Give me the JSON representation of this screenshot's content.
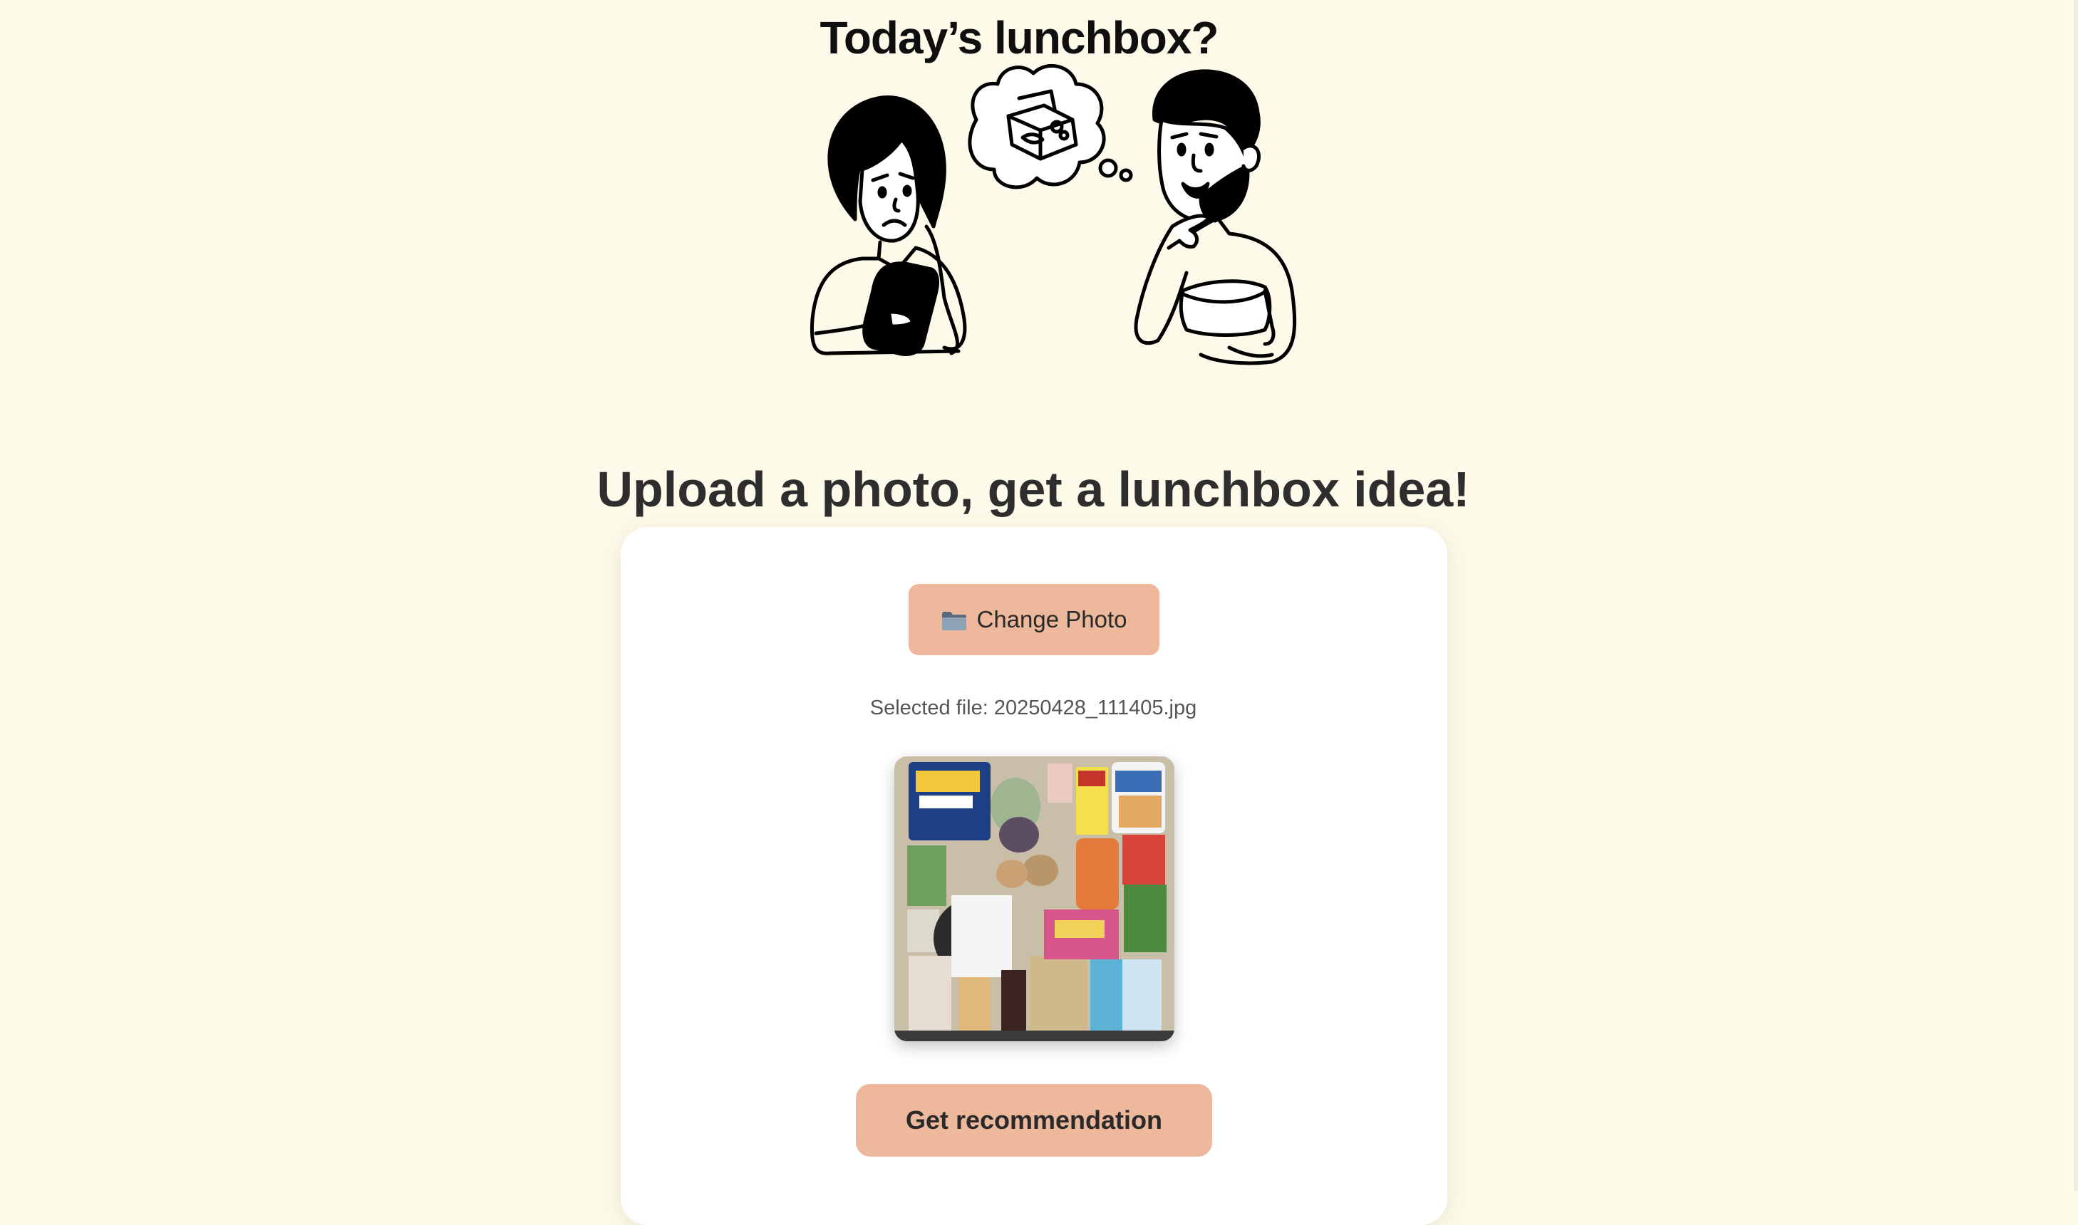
{
  "header": {
    "title": "Today’s lunchbox?"
  },
  "main": {
    "headline": "Upload a photo, get a lunchbox idea!"
  },
  "upload": {
    "change_photo_label": "Change Photo",
    "change_photo_icon": "folder-icon",
    "selected_file_text": "Selected file: 20250428_111405.jpg",
    "preview_image": "uploaded-photo-preview"
  },
  "actions": {
    "recommend_label": "Get recommendation"
  },
  "colors": {
    "background": "#fdfaea",
    "card": "#ffffff",
    "button": "#edb89c",
    "text": "#2e2e2e"
  }
}
